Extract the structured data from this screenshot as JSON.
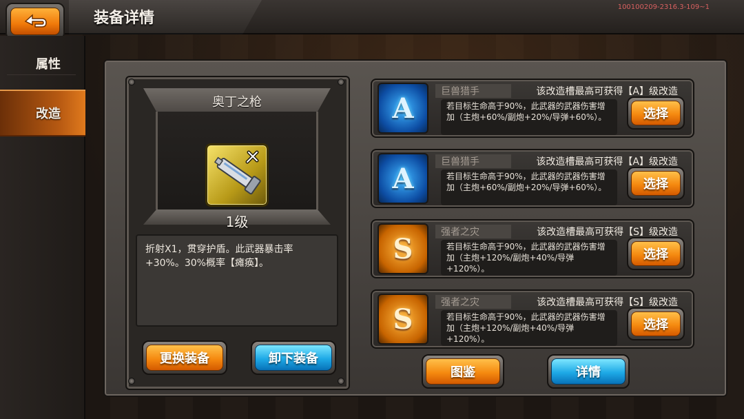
{
  "header": {
    "title": "装备详情",
    "build_id": "100100209-2316.3-109~1"
  },
  "sidebar": {
    "tabs": [
      {
        "label": "属性",
        "active": false
      },
      {
        "label": "改造",
        "active": true
      }
    ]
  },
  "equipment": {
    "name": "奥丁之枪",
    "level": "1级",
    "description": "折射X1，贯穿护盾。此武器暴击率+30%。30%概率【瘫痪】。",
    "icon": "gun-with-wrench-icon",
    "buttons": {
      "replace": "更换装备",
      "unequip": "卸下装备"
    }
  },
  "slots": [
    {
      "grade": "A",
      "name": "巨兽猎手",
      "limit": "该改造槽最高可获得【A】级改造",
      "description": "若目标生命高于90%，此武器的武器伤害增加（主炮+60%/副炮+20%/导弹+60%）。",
      "button": "选择"
    },
    {
      "grade": "A",
      "name": "巨兽猎手",
      "limit": "该改造槽最高可获得【A】级改造",
      "description": "若目标生命高于90%，此武器的武器伤害增加（主炮+60%/副炮+20%/导弹+60%）。",
      "button": "选择"
    },
    {
      "grade": "S",
      "name": "强者之灾",
      "limit": "该改造槽最高可获得【S】级改造",
      "description": "若目标生命高于90%，此武器的武器伤害增加（主炮+120%/副炮+40%/导弹+120%）。",
      "button": "选择"
    },
    {
      "grade": "S",
      "name": "强者之灾",
      "limit": "该改造槽最高可获得【S】级改造",
      "description": "若目标生命高于90%，此武器的武器伤害增加（主炮+120%/副炮+40%/导弹+120%）。",
      "button": "选择"
    }
  ],
  "footer": {
    "catalog": "图鉴",
    "details": "详情"
  },
  "colors": {
    "accent_orange": "#f58a10",
    "accent_blue": "#1ea9e6",
    "grade_a": "#0d4da3",
    "grade_s": "#c76400"
  }
}
